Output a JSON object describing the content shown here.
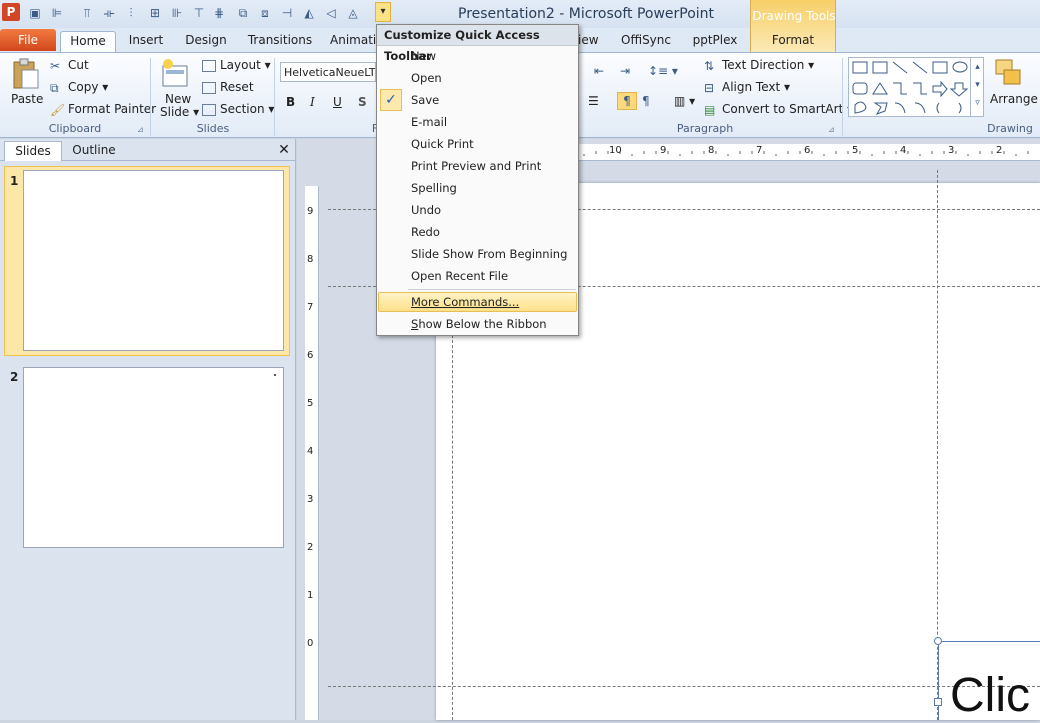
{
  "window": {
    "title": "Presentation2  -  Microsoft PowerPoint",
    "app_icon": "P",
    "contextual_group": "Drawing Tools"
  },
  "qat": {
    "icons": [
      "save-icon",
      "align-left-icon",
      "bar-chart-icon",
      "distribute-icon",
      "align-center-icon",
      "align-middle-icon",
      "columns-icon",
      "align-top-icon",
      "align-icon",
      "distribute-vertical-icon",
      "group-icon",
      "flip-icon",
      "flip-horizontal-icon",
      "rotate-icon",
      "shape-icon"
    ],
    "dropdown_glyph": "▾"
  },
  "tabs": [
    "File",
    "Home",
    "Insert",
    "Design",
    "Transitions",
    "Animati",
    "iew",
    "OffiSync",
    "pptPlex",
    "Format"
  ],
  "ribbon": {
    "clipboard": {
      "paste": "Paste",
      "cut": "Cut",
      "copy": "Copy",
      "format_painter": "Format Painter",
      "label": "Clipboard"
    },
    "slides": {
      "new_slide_1": "New",
      "new_slide_2": "Slide",
      "layout": "Layout",
      "reset": "Reset",
      "section": "Section",
      "label": "Slides"
    },
    "font": {
      "font_name": "HelveticaNeueLT S",
      "bold": "B",
      "italic": "I",
      "underline": "U",
      "shadow": "S",
      "label": "F"
    },
    "paragraph": {
      "text_direction": "Text Direction",
      "align_text": "Align Text",
      "convert_smartart": "Convert to SmartArt",
      "label": "Paragraph"
    },
    "drawing": {
      "arrange": "Arrange",
      "label": "Drawing"
    }
  },
  "slides_pane": {
    "tab_slides": "Slides",
    "tab_outline": "Outline",
    "close": "✕",
    "slide_numbers": [
      "1",
      "2"
    ]
  },
  "rulers": {
    "h_ticks": [
      "10",
      "9",
      "8",
      "7",
      "6",
      "5",
      "4",
      "3",
      "2"
    ],
    "v_ticks": [
      "9",
      "8",
      "7",
      "6",
      "5",
      "4",
      "3",
      "2",
      "1",
      "0"
    ]
  },
  "slide": {
    "placeholder_text": "Clic"
  },
  "menu": {
    "header": "Customize Quick Access Toolbar",
    "items": [
      "New",
      "Open",
      "Save",
      "E-mail",
      "Quick Print",
      "Print Preview and Print",
      "Spelling",
      "Undo",
      "Redo",
      "Slide Show From Beginning",
      "Open Recent File"
    ],
    "checked_item": "Save",
    "check_glyph": "✓",
    "more_commands": "More Commands...",
    "show_below": "Show Below the Ribbon"
  }
}
